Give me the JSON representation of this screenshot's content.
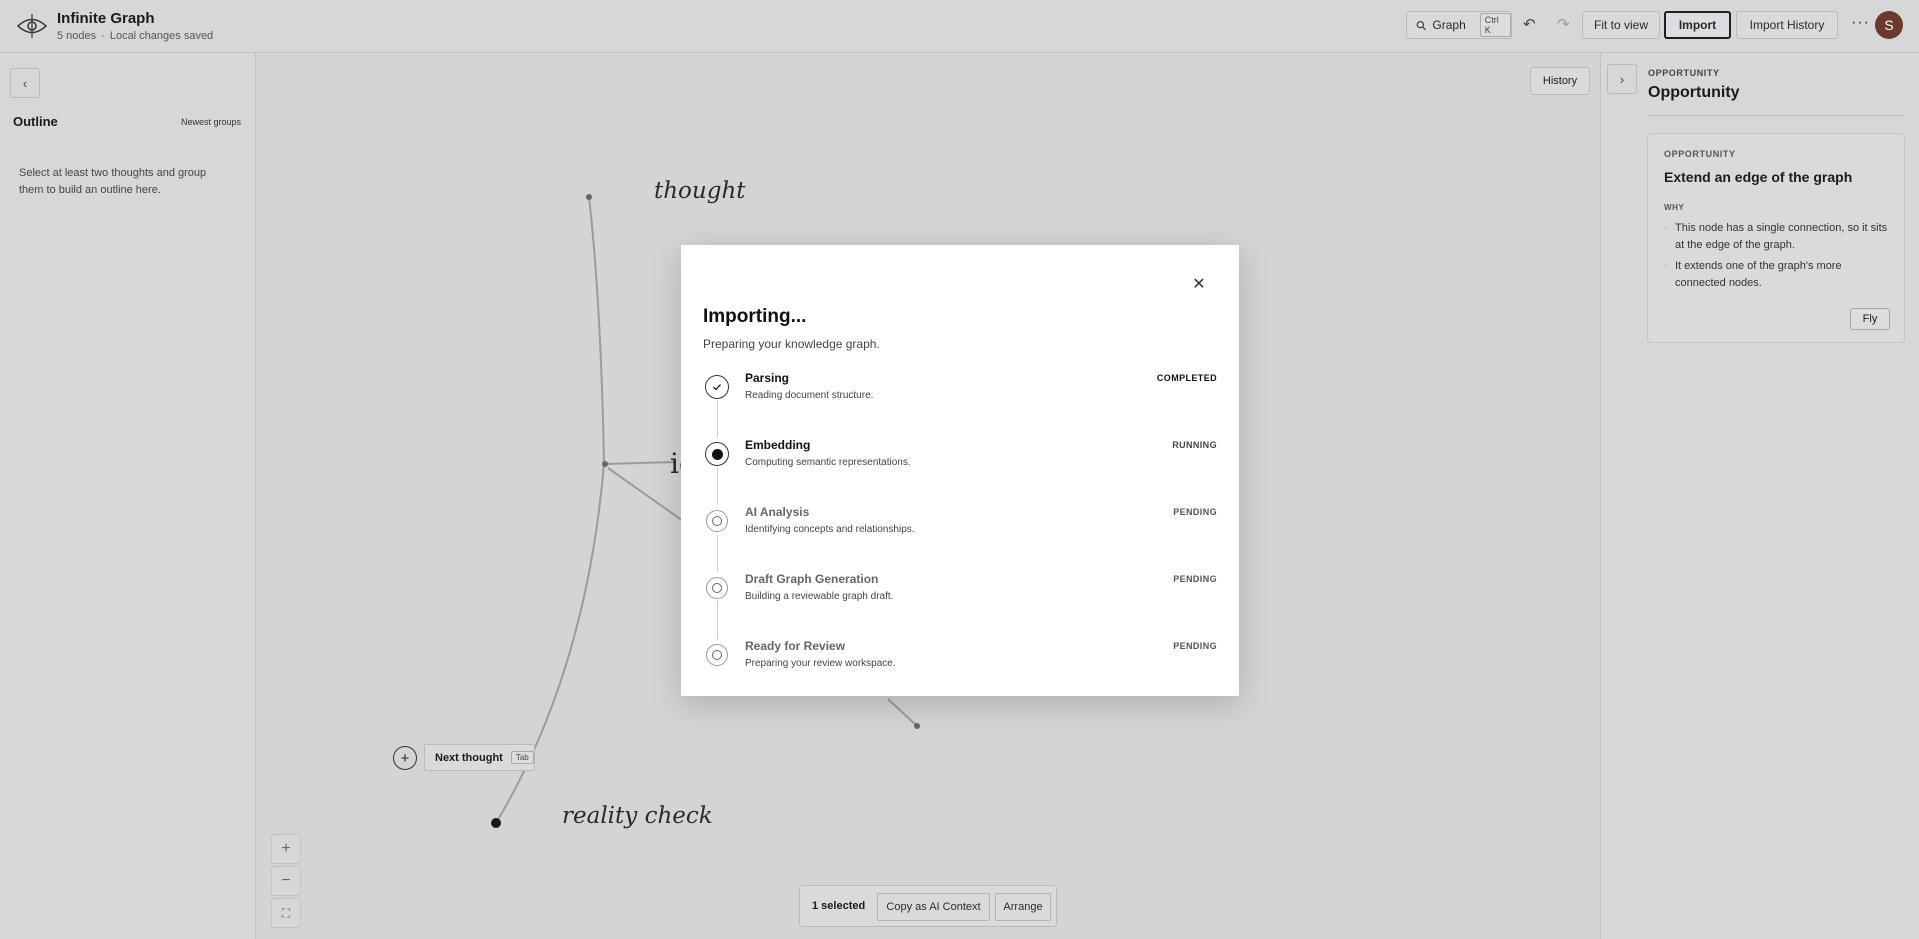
{
  "header": {
    "title": "Infinite Graph",
    "node_count": "5 nodes",
    "save_status": "Local changes saved",
    "search_label": "Graph",
    "search_shortcut": "Ctrl K",
    "fit_label": "Fit to view",
    "import_label": "Import",
    "import_history_label": "Import History",
    "avatar_initial": "S"
  },
  "outline": {
    "title": "Outline",
    "sort_label": "Newest groups",
    "empty_text": "Select at least two thoughts and group them to build an outline here."
  },
  "canvas": {
    "history_label": "History",
    "nodes": {
      "thought": "thought",
      "reality": "reality check",
      "center_fragment": "io"
    },
    "next_thought_label": "Next thought",
    "next_thought_key": "Tab"
  },
  "selection_bar": {
    "count": "1 selected",
    "copy_label": "Copy as AI Context",
    "arrange_label": "Arrange"
  },
  "right_panel": {
    "kicker": "OPPORTUNITY",
    "title": "Opportunity",
    "card": {
      "kicker": "OPPORTUNITY",
      "title": "Extend an edge of the graph",
      "why_label": "WHY",
      "reasons": [
        "This node has a single connection, so it sits at the edge of the graph.",
        "It extends one of the graph's more connected nodes."
      ],
      "fly_label": "Fly"
    }
  },
  "modal": {
    "title": "Importing...",
    "subtitle": "Preparing your knowledge graph.",
    "steps": [
      {
        "name": "Parsing",
        "desc": "Reading document structure.",
        "status": "COMPLETED"
      },
      {
        "name": "Embedding",
        "desc": "Computing semantic representations.",
        "status": "RUNNING"
      },
      {
        "name": "AI Analysis",
        "desc": "Identifying concepts and relationships.",
        "status": "PENDING"
      },
      {
        "name": "Draft Graph Generation",
        "desc": "Building a reviewable graph draft.",
        "status": "PENDING"
      },
      {
        "name": "Ready for Review",
        "desc": "Preparing your review workspace.",
        "status": "PENDING"
      }
    ]
  }
}
